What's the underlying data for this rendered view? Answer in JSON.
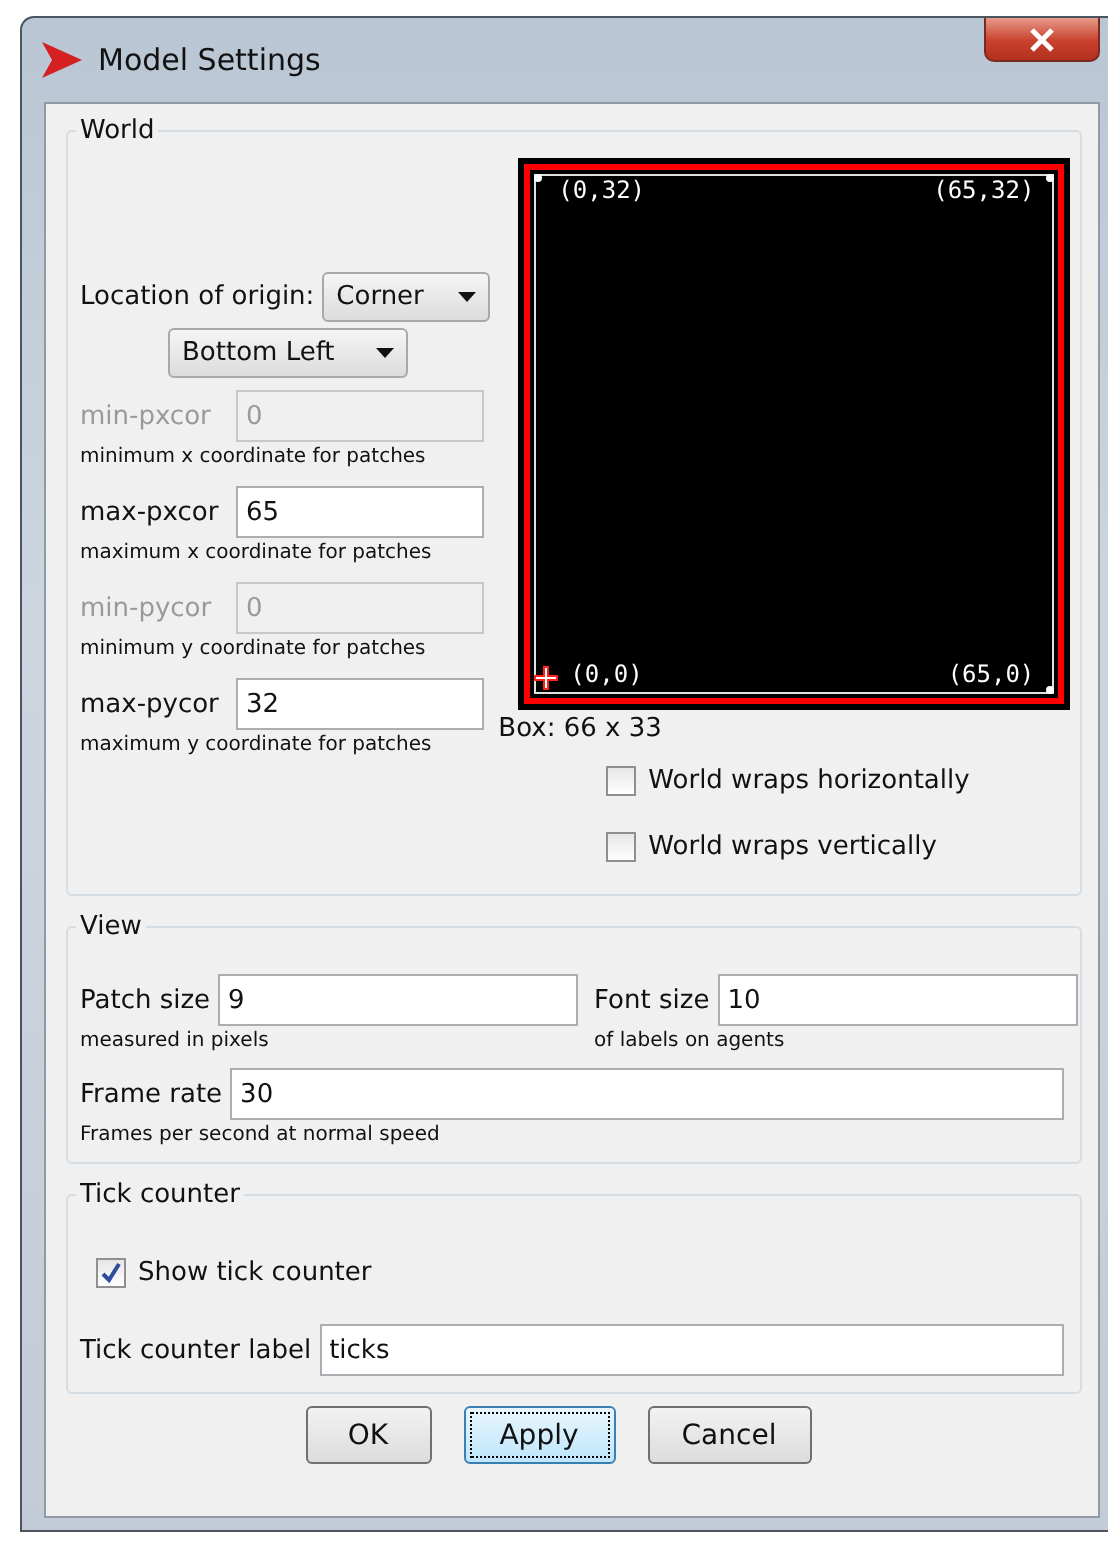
{
  "window": {
    "title": "Model Settings"
  },
  "world": {
    "legend": "World",
    "origin": {
      "label": "Location of origin:",
      "mode": "Corner",
      "corner": "Bottom Left"
    },
    "fields": [
      {
        "label": "min-pxcor",
        "value": "0",
        "hint": "minimum x coordinate for patches",
        "disabled": true
      },
      {
        "label": "max-pxcor",
        "value": "65",
        "hint": "maximum x coordinate for patches",
        "disabled": false
      },
      {
        "label": "min-pycor",
        "value": "0",
        "hint": "minimum y coordinate for patches",
        "disabled": true
      },
      {
        "label": "max-pycor",
        "value": "32",
        "hint": "maximum y coordinate for patches",
        "disabled": false
      }
    ],
    "preview": {
      "corners": [
        {
          "text": "(0,32)",
          "dot": true
        },
        {
          "text": "(65,32)",
          "dot": true
        },
        {
          "text": "(0,0)",
          "dot": false
        },
        {
          "text": "(65,0)",
          "dot": true
        }
      ]
    },
    "box_size": "Box: 66 x 33",
    "wraps": [
      {
        "label": "World wraps horizontally",
        "checked": false
      },
      {
        "label": "World wraps vertically",
        "checked": false
      }
    ]
  },
  "view": {
    "legend": "View",
    "rows": [
      [
        {
          "label": "Patch size",
          "value": "9",
          "hint": "measured in pixels"
        },
        {
          "label": "Font size",
          "value": "10",
          "hint": "of labels on agents"
        }
      ],
      [
        {
          "label": "Frame rate",
          "value": "30",
          "hint": "Frames per second at normal speed"
        }
      ]
    ]
  },
  "tick_counter": {
    "legend": "Tick counter",
    "show": {
      "label": "Show tick counter",
      "checked": true
    },
    "field": {
      "label": "Tick counter label",
      "value": "ticks"
    }
  },
  "buttons": [
    {
      "label": "OK",
      "focused": false
    },
    {
      "label": "Apply",
      "focused": true
    },
    {
      "label": "Cancel",
      "focused": false
    }
  ]
}
